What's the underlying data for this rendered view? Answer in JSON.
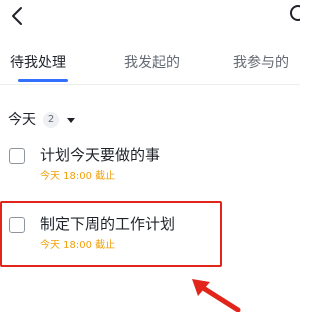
{
  "header": {
    "back_icon": "chevron-left-icon",
    "right_icon": "partial-icon"
  },
  "tabs": [
    {
      "label": "待我处理",
      "active": true
    },
    {
      "label": "我发起的",
      "active": false
    },
    {
      "label": "我参与的",
      "active": false
    }
  ],
  "colors": {
    "accent": "#3370ff",
    "due": "#f0a10a",
    "annotation": "#e1251b"
  },
  "group": {
    "title": "今天",
    "count": "2"
  },
  "tasks": [
    {
      "title": "计划今天要做的事",
      "due": "今天 18:00 截止"
    },
    {
      "title": "制定下周的工作计划",
      "due": "今天 18:00 截止"
    }
  ]
}
